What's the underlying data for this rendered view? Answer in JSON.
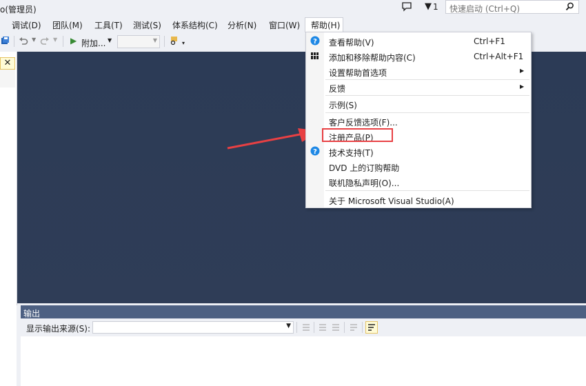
{
  "window": {
    "title": "o(管理员)"
  },
  "titlebar": {
    "notifications_count": "1",
    "quick_launch_placeholder": "快速启动 (Ctrl+Q)"
  },
  "menubar": {
    "items": [
      {
        "label": "调试(D)"
      },
      {
        "label": "团队(M)"
      },
      {
        "label": "工具(T)"
      },
      {
        "label": "测试(S)"
      },
      {
        "label": "体系结构(C)"
      },
      {
        "label": "分析(N)"
      },
      {
        "label": "窗口(W)"
      },
      {
        "label": "帮助(H)"
      }
    ]
  },
  "toolbar": {
    "attach_label": "附加..."
  },
  "help_menu": {
    "items": [
      {
        "label": "查看帮助(V)",
        "shortcut": "Ctrl+F1",
        "icon": "help-circle-icon"
      },
      {
        "label": "添加和移除帮助内容(C)",
        "shortcut": "Ctrl+Alt+F1",
        "icon": "library-icon"
      },
      {
        "label": "设置帮助首选项",
        "submenu": true
      },
      {
        "label": "反馈",
        "submenu": true
      },
      {
        "label": "示例(S)"
      },
      {
        "label": "客户反馈选项(F)..."
      },
      {
        "label": "注册产品(P)",
        "highlighted": true
      },
      {
        "label": "技术支持(T)",
        "icon": "help-circle-icon"
      },
      {
        "label": "DVD 上的订购帮助"
      },
      {
        "label": "联机隐私声明(O)..."
      },
      {
        "label": "关于 Microsoft Visual Studio(A)"
      }
    ]
  },
  "output_panel": {
    "title": "输出",
    "source_label": "显示输出来源(S):",
    "source_value": ""
  },
  "colors": {
    "editor_background": "#2c3b56",
    "output_header": "#4d6082",
    "highlight_border": "#e84043",
    "arrow": "#e84043",
    "help_icon": "#1e88e5"
  }
}
